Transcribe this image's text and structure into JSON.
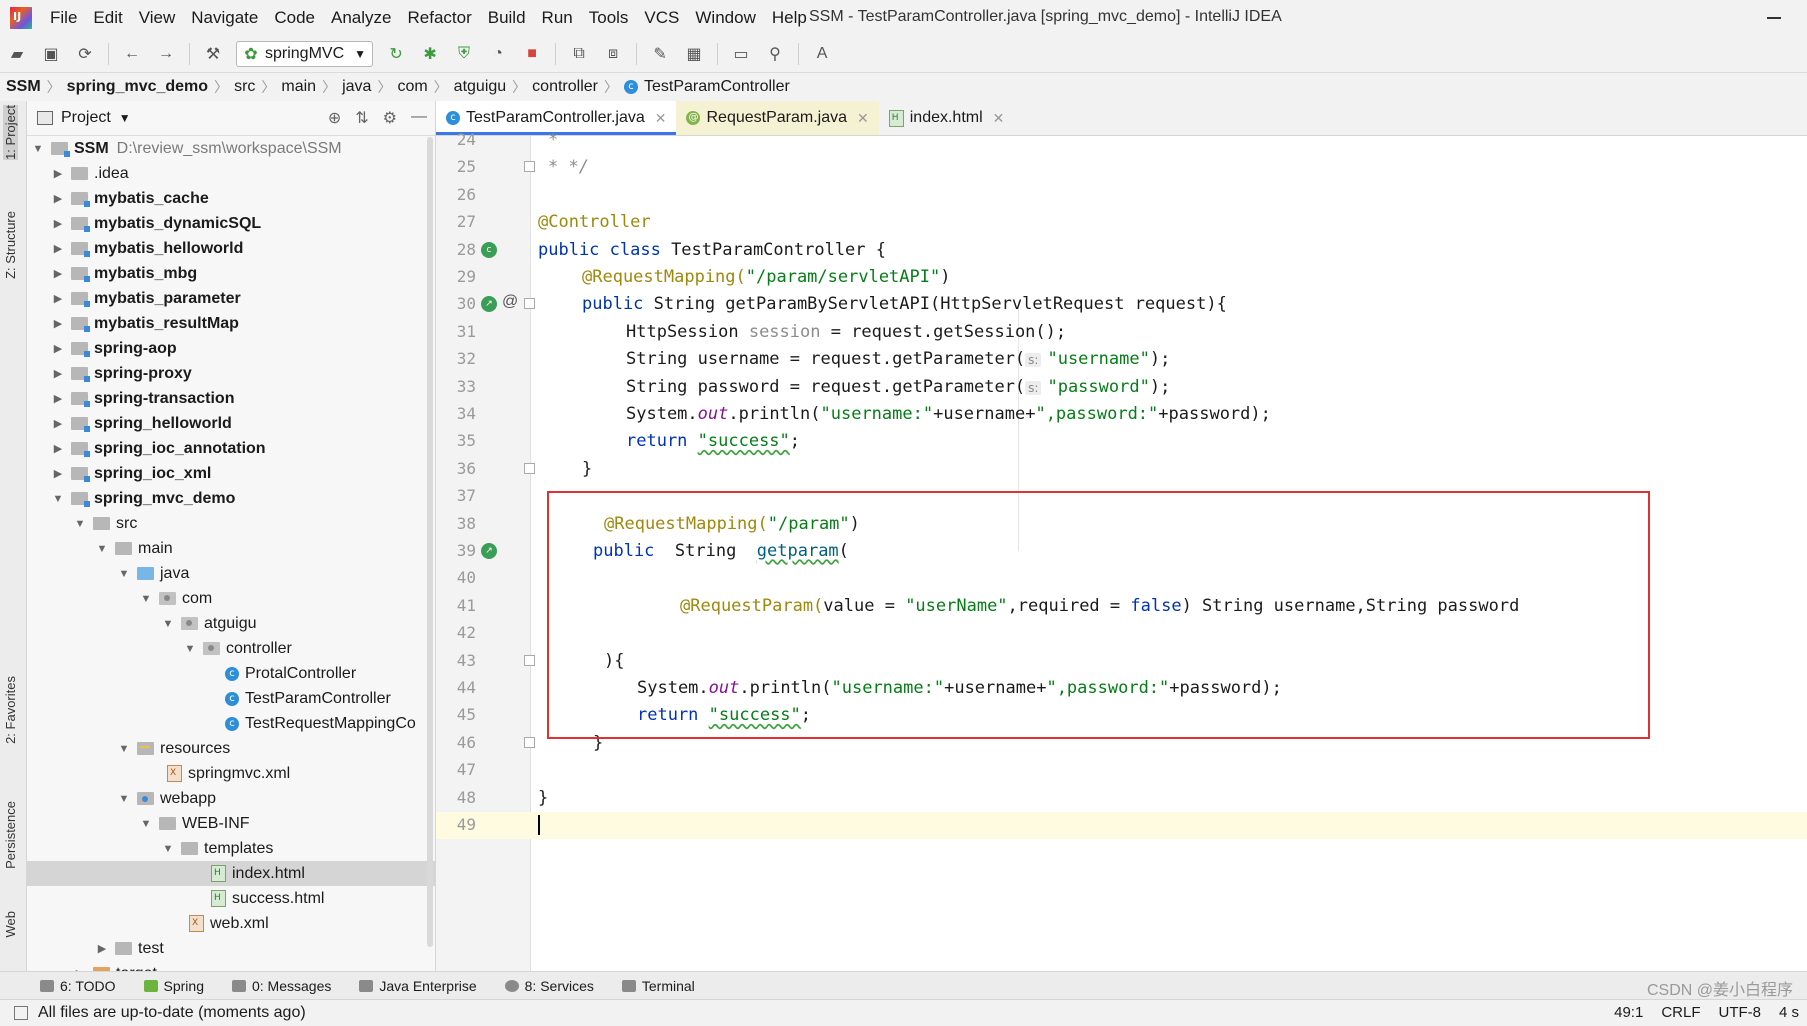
{
  "menubar": {
    "items": [
      "File",
      "Edit",
      "View",
      "Navigate",
      "Code",
      "Analyze",
      "Refactor",
      "Build",
      "Run",
      "Tools",
      "VCS",
      "Window",
      "Help"
    ],
    "title": "SSM - TestParamController.java [spring_mvc_demo] - IntelliJ IDEA"
  },
  "toolbar": {
    "run_config": "springMVC"
  },
  "breadcrumb": [
    "SSM",
    "spring_mvc_demo",
    "src",
    "main",
    "java",
    "com",
    "atguigu",
    "controller",
    "TestParamController"
  ],
  "left_tools": [
    "1: Project",
    "Z: Structure",
    "2: Favorites",
    "Persistence",
    "Web"
  ],
  "project": {
    "title": "Project",
    "tree": [
      {
        "label": "SSM",
        "path": "D:\\review_ssm\\workspace\\SSM"
      },
      {
        "label": ".idea"
      },
      {
        "label": "mybatis_cache"
      },
      {
        "label": "mybatis_dynamicSQL"
      },
      {
        "label": "mybatis_helloworld"
      },
      {
        "label": "mybatis_mbg"
      },
      {
        "label": "mybatis_parameter"
      },
      {
        "label": "mybatis_resultMap"
      },
      {
        "label": "spring-aop"
      },
      {
        "label": "spring-proxy"
      },
      {
        "label": "spring-transaction"
      },
      {
        "label": "spring_helloworld"
      },
      {
        "label": "spring_ioc_annotation"
      },
      {
        "label": "spring_ioc_xml"
      },
      {
        "label": "spring_mvc_demo"
      },
      {
        "label": "src"
      },
      {
        "label": "main"
      },
      {
        "label": "java"
      },
      {
        "label": "com"
      },
      {
        "label": "atguigu"
      },
      {
        "label": "controller"
      },
      {
        "label": "ProtalController"
      },
      {
        "label": "TestParamController"
      },
      {
        "label": "TestRequestMappingCo"
      },
      {
        "label": "resources"
      },
      {
        "label": "springmvc.xml"
      },
      {
        "label": "webapp"
      },
      {
        "label": "WEB-INF"
      },
      {
        "label": "templates"
      },
      {
        "label": "index.html"
      },
      {
        "label": "success.html"
      },
      {
        "label": "web.xml"
      },
      {
        "label": "test"
      },
      {
        "label": "target"
      }
    ]
  },
  "tabs": [
    {
      "label": "TestParamController.java",
      "icon": "class-icon"
    },
    {
      "label": "RequestParam.java",
      "icon": "annotation-icon"
    },
    {
      "label": "index.html",
      "icon": "html-file-icon"
    }
  ],
  "editor": {
    "line_numbers": [
      "24",
      "25",
      "26",
      "27",
      "28",
      "29",
      "30",
      "31",
      "32",
      "33",
      "34",
      "35",
      "36",
      "37",
      "38",
      "39",
      "40",
      "41",
      "42",
      "43",
      "44",
      "45",
      "46",
      "47",
      "48",
      "49"
    ],
    "code": {
      "l24": "*",
      "l25": "* */",
      "l27": "@Controller",
      "l28_kw": "public class",
      "l28_rest": " TestParamController {",
      "l29_an": "@RequestMapping(",
      "l29_str": "\"/param/servletAPI\"",
      "l29_end": ")",
      "l30_kw": "public",
      "l30_rest": " String getParamByServletAPI(HttpServletRequest request){",
      "l31_a": "HttpSession ",
      "l31_b": "session",
      "l31_c": " = request.getSession();",
      "l32_a": "String username = request.getParameter(",
      "l32_hint": "s:",
      "l32_str": "\"username\"",
      "l32_end": ");",
      "l33_a": "String password = request.getParameter(",
      "l33_hint": "s:",
      "l33_str": "\"password\"",
      "l33_end": ");",
      "l34_a": "System.",
      "l34_out": "out",
      "l34_b": ".println(",
      "l34_s1": "\"username:\"",
      "l34_c": "+username+",
      "l34_s2": "\",password:\"",
      "l34_d": "+password);",
      "l35_kw": "return ",
      "l35_str": "\"success\"",
      "l35_end": ";",
      "l36": "}",
      "l38_an": "@RequestMapping(",
      "l38_str": "\"/param\"",
      "l38_end": ")",
      "l39_kw": "public",
      "l39_a": "  String  ",
      "l39_b": "getparam",
      "l39_c": "(",
      "l41_an": "@RequestParam(",
      "l41_a": "value = ",
      "l41_s": "\"userName\"",
      "l41_b": ",required = ",
      "l41_kw": "false",
      "l41_c": ") String username,String password",
      "l43": "){",
      "l44_a": "System.",
      "l44_out": "out",
      "l44_b": ".println(",
      "l44_s1": "\"username:\"",
      "l44_c": "+username+",
      "l44_s2": "\",password:\"",
      "l44_d": "+password);",
      "l45_kw": "return ",
      "l45_str": "\"success\"",
      "l45_end": ";",
      "l46": "}",
      "l48": "}"
    }
  },
  "bottom_tools": [
    "6: TODO",
    "Spring",
    "0: Messages",
    "Java Enterprise",
    "8: Services",
    "Terminal"
  ],
  "watermark": "CSDN @姜小白程序",
  "status": {
    "message": "All files are up-to-date (moments ago)",
    "position": "49:1",
    "line_sep": "CRLF",
    "encoding": "UTF-8",
    "indent": "4 s"
  },
  "colors": {
    "keyword": "#0033b3",
    "annotation": "#9e880d",
    "string": "#067d17",
    "highlight_box": "#e03030",
    "active_tab_underline": "#3b78e7"
  }
}
